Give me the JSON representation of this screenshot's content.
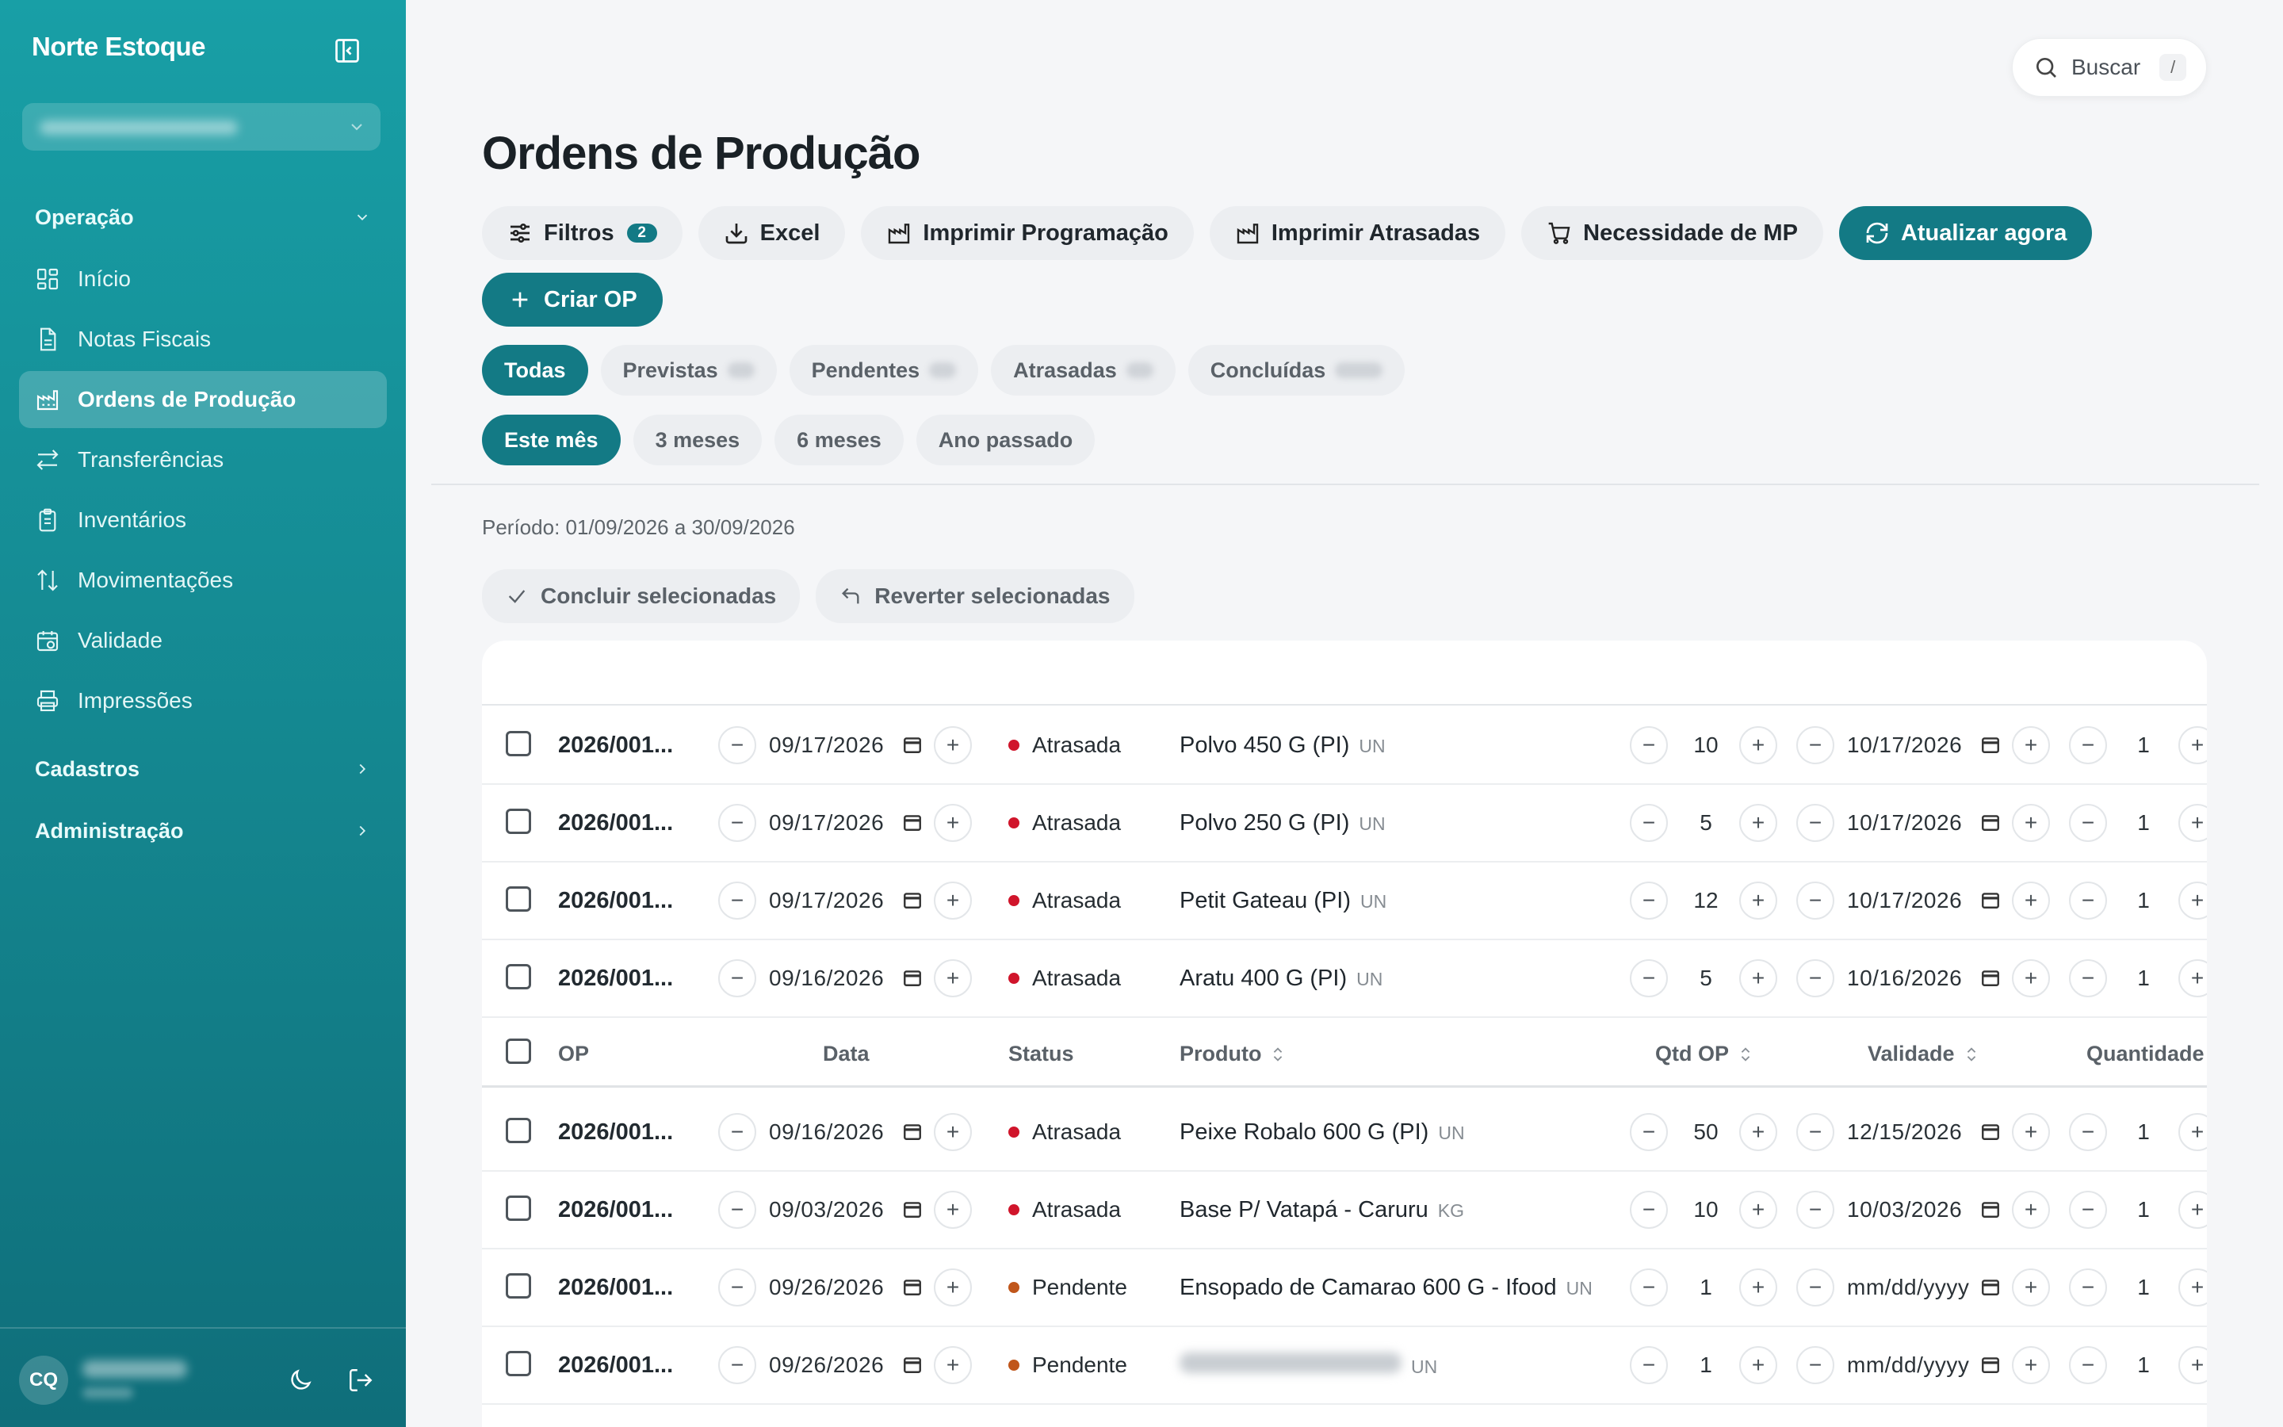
{
  "app": {
    "brand": "Norte Estoque"
  },
  "sidebar": {
    "sections": {
      "operacao": "Operação",
      "cadastros": "Cadastros",
      "administracao": "Administração"
    },
    "items": [
      {
        "label": "Início",
        "icon": "grid-icon"
      },
      {
        "label": "Notas Fiscais",
        "icon": "document-icon"
      },
      {
        "label": "Ordens de Produção",
        "icon": "factory-icon",
        "active": true
      },
      {
        "label": "Transferências",
        "icon": "arrows-swap-icon"
      },
      {
        "label": "Inventários",
        "icon": "clipboard-icon"
      },
      {
        "label": "Movimentações",
        "icon": "arrows-updown-icon"
      },
      {
        "label": "Validade",
        "icon": "calendar-clock-icon"
      },
      {
        "label": "Impressões",
        "icon": "printer-icon"
      }
    ],
    "user": {
      "initials": "CQ"
    }
  },
  "header": {
    "search_label": "Buscar",
    "search_shortcut": "/"
  },
  "page": {
    "title": "Ordens de Produção"
  },
  "toolbar": {
    "filters": "Filtros",
    "filters_count": "2",
    "excel": "Excel",
    "print_schedule": "Imprimir Programação",
    "print_late": "Imprimir Atrasadas",
    "mp_need": "Necessidade de MP",
    "refresh": "Atualizar agora",
    "create": "Criar OP"
  },
  "status_tabs": [
    "Todas",
    "Previstas",
    "Pendentes",
    "Atrasadas",
    "Concluídas"
  ],
  "period_tabs": [
    "Este mês",
    "3 meses",
    "6 meses",
    "Ano passado"
  ],
  "period_text": "Período: 01/09/2026 a 30/09/2026",
  "bulk": {
    "complete": "Concluir selecionadas",
    "revert": "Reverter selecionadas"
  },
  "table": {
    "columns": {
      "op": "OP",
      "date": "Data",
      "status": "Status",
      "product": "Produto",
      "qty_op": "Qtd OP",
      "validity": "Validade",
      "quantity": "Quantidade"
    },
    "rows_top": [
      {
        "op": "2026/001...",
        "date": "09/17/2026",
        "status": "Atrasada",
        "product": "Polvo 450 G (PI)",
        "unit": "UN",
        "qty": "10",
        "validity": "10/17/2026",
        "quantity": "1"
      },
      {
        "op": "2026/001...",
        "date": "09/17/2026",
        "status": "Atrasada",
        "product": "Polvo 250 G (PI)",
        "unit": "UN",
        "qty": "5",
        "validity": "10/17/2026",
        "quantity": "1"
      },
      {
        "op": "2026/001...",
        "date": "09/17/2026",
        "status": "Atrasada",
        "product": "Petit Gateau (PI)",
        "unit": "UN",
        "qty": "12",
        "validity": "10/17/2026",
        "quantity": "1"
      },
      {
        "op": "2026/001...",
        "date": "09/16/2026",
        "status": "Atrasada",
        "product": "Aratu 400 G (PI)",
        "unit": "UN",
        "qty": "5",
        "validity": "10/16/2026",
        "quantity": "1"
      }
    ],
    "rows_bottom": [
      {
        "op": "2026/001...",
        "date": "09/16/2026",
        "status": "Atrasada",
        "product": "Peixe Robalo 600 G (PI)",
        "unit": "UN",
        "qty": "50",
        "validity": "12/15/2026",
        "quantity": "1"
      },
      {
        "op": "2026/001...",
        "date": "09/03/2026",
        "status": "Atrasada",
        "product": "Base P/ Vatapá - Caruru",
        "unit": "KG",
        "qty": "10",
        "validity": "10/03/2026",
        "quantity": "1"
      },
      {
        "op": "2026/001...",
        "date": "09/26/2026",
        "status": "Pendente",
        "product": "Ensopado de Camarao 600 G - Ifood",
        "unit": "UN",
        "qty": "1",
        "validity": "mm/dd/yyyy",
        "quantity": "1"
      },
      {
        "op": "2026/001...",
        "date": "09/26/2026",
        "status": "Pendente",
        "product": "",
        "unit": "UN",
        "qty": "1",
        "validity": "mm/dd/yyyy",
        "quantity": "1"
      }
    ]
  },
  "colors": {
    "accent": "#137a85",
    "late": "#d0152b",
    "pending": "#c0561b"
  }
}
